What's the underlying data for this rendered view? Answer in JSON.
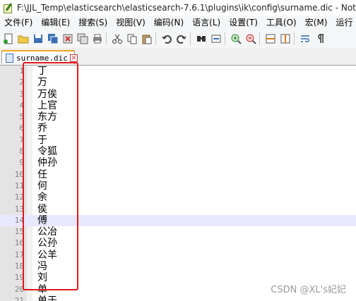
{
  "window": {
    "title": "F:\\JJL_Temp\\elasticsearch\\elasticsearch-7.6.1\\plugins\\ik\\config\\surname.dic - Notepad++",
    "app_icon": "notepad-plus-plus-icon"
  },
  "menu": {
    "items": [
      "文件(F)",
      "编辑(E)",
      "搜索(S)",
      "视图(V)",
      "编码(N)",
      "语言(L)",
      "设置(T)",
      "工具(O)",
      "宏(M)",
      "运行"
    ]
  },
  "toolbar": {
    "icons": [
      "new-file-icon",
      "open-file-icon",
      "save-icon",
      "save-all-icon",
      "close-icon",
      "close-all-icon",
      "print-icon",
      "cut-icon",
      "copy-icon",
      "paste-icon",
      "undo-icon",
      "redo-icon",
      "find-icon",
      "replace-icon",
      "zoom-in-icon",
      "zoom-out-icon",
      "sync-vertical-icon",
      "sync-horizontal-icon",
      "word-wrap-icon",
      "show-all-chars-icon"
    ]
  },
  "tab": {
    "label": "surname.dic",
    "close_glyph": "✕"
  },
  "editor": {
    "current_line": 14,
    "lines": [
      {
        "n": "1",
        "text": "丁"
      },
      {
        "n": "2",
        "text": "万"
      },
      {
        "n": "3",
        "text": "万俟"
      },
      {
        "n": "4",
        "text": "上官"
      },
      {
        "n": "5",
        "text": "东方"
      },
      {
        "n": "6",
        "text": "乔"
      },
      {
        "n": "7",
        "text": "于"
      },
      {
        "n": "8",
        "text": "令狐"
      },
      {
        "n": "9",
        "text": "仲孙"
      },
      {
        "n": "10",
        "text": "任"
      },
      {
        "n": "11",
        "text": "何"
      },
      {
        "n": "12",
        "text": "余"
      },
      {
        "n": "13",
        "text": "侯"
      },
      {
        "n": "14",
        "text": "傅"
      },
      {
        "n": "15",
        "text": "公冶"
      },
      {
        "n": "16",
        "text": "公孙"
      },
      {
        "n": "17",
        "text": "公羊"
      },
      {
        "n": "18",
        "text": "冯"
      },
      {
        "n": "19",
        "text": "刘"
      },
      {
        "n": "20",
        "text": "单"
      },
      {
        "n": "21",
        "text": "单于"
      }
    ]
  },
  "watermark": "CSDN @XL's妃妃",
  "colors": {
    "annotation_box": "#e0191e",
    "current_line_bg": "#e8e8ff",
    "tab_accent": "#f5a623",
    "gutter_bg": "#e4e4e4"
  }
}
